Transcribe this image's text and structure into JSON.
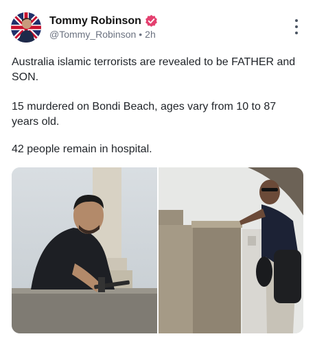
{
  "author": {
    "display_name": "Tommy Robinson",
    "handle": "@Tommy_Robinson",
    "time": "2h",
    "separator": "•",
    "verified_icon": "verified-badge-icon",
    "badge_color": "#e4406f"
  },
  "post": {
    "paragraphs": [
      "Australia islamic terrorists are revealed to be FATHER and SON.",
      "15 murdered on Bondi Beach, ages vary from 10 to 87 years old.",
      "42 people remain in hospital."
    ]
  },
  "media": {
    "images": [
      {
        "icon": "photo-young-man-with-rifle"
      },
      {
        "icon": "photo-man-with-bag-on-ledge"
      }
    ]
  },
  "menu": {
    "icon": "more-vertical-icon"
  }
}
